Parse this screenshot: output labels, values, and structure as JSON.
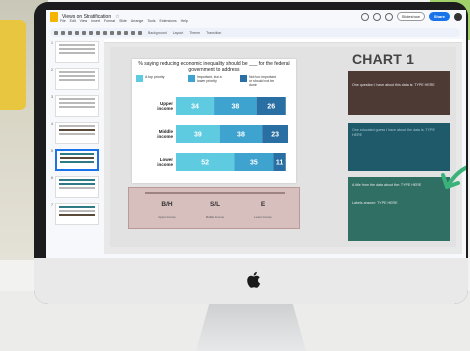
{
  "window": {
    "doc_title": "Views on Stratification",
    "menu": [
      "File",
      "Edit",
      "View",
      "Insert",
      "Format",
      "Slide",
      "Arrange",
      "Tools",
      "Extensions",
      "Help"
    ],
    "slideshow_label": "Slideshow",
    "share_label": "Share",
    "toolbar_items": [
      "Background",
      "Layout",
      "Theme",
      "Transition"
    ]
  },
  "filmstrip": {
    "slide_numbers": [
      "1",
      "2",
      "3",
      "4",
      "5",
      "6",
      "7"
    ]
  },
  "chart_card": {
    "title": "% saying reducing economic inequality should be ___ for the federal government to address",
    "legend": [
      "A top priority",
      "Important, but a lower priority",
      "Not too important or should not be done"
    ]
  },
  "chart_data": {
    "type": "bar",
    "stacked": true,
    "orientation": "horizontal",
    "categories": [
      "Upper income",
      "Middle income",
      "Lower income"
    ],
    "series": [
      {
        "name": "A top priority",
        "values": [
          34,
          39,
          52
        ]
      },
      {
        "name": "Important, but a lower priority",
        "values": [
          38,
          38,
          35
        ]
      },
      {
        "name": "Not too important or should not be done",
        "values": [
          26,
          23,
          11
        ]
      }
    ],
    "colors": [
      "#5ecbe0",
      "#3ea3cf",
      "#2a6fa3"
    ]
  },
  "answer": {
    "cols": [
      {
        "value": "B/H",
        "label": "Upper Income"
      },
      {
        "value": "S/L",
        "label": "Middle Income"
      },
      {
        "value": "E",
        "label": "Lower Income"
      }
    ]
  },
  "right": {
    "heading": "CHART 1",
    "panel1": "One question I have about this data is: TYPE HERE",
    "panel2": "One educated guess I have about the data is: TYPE HERE",
    "panel3a": "A title from the data about the: TYPE HERE",
    "panel3b": "Labels answer: TYPE HERE"
  },
  "colors": {
    "panel_dark": "#4e3a35",
    "panel_teal": "#1f5a6b",
    "panel_green": "#2f6f64",
    "arrow": "#3ab27a"
  }
}
